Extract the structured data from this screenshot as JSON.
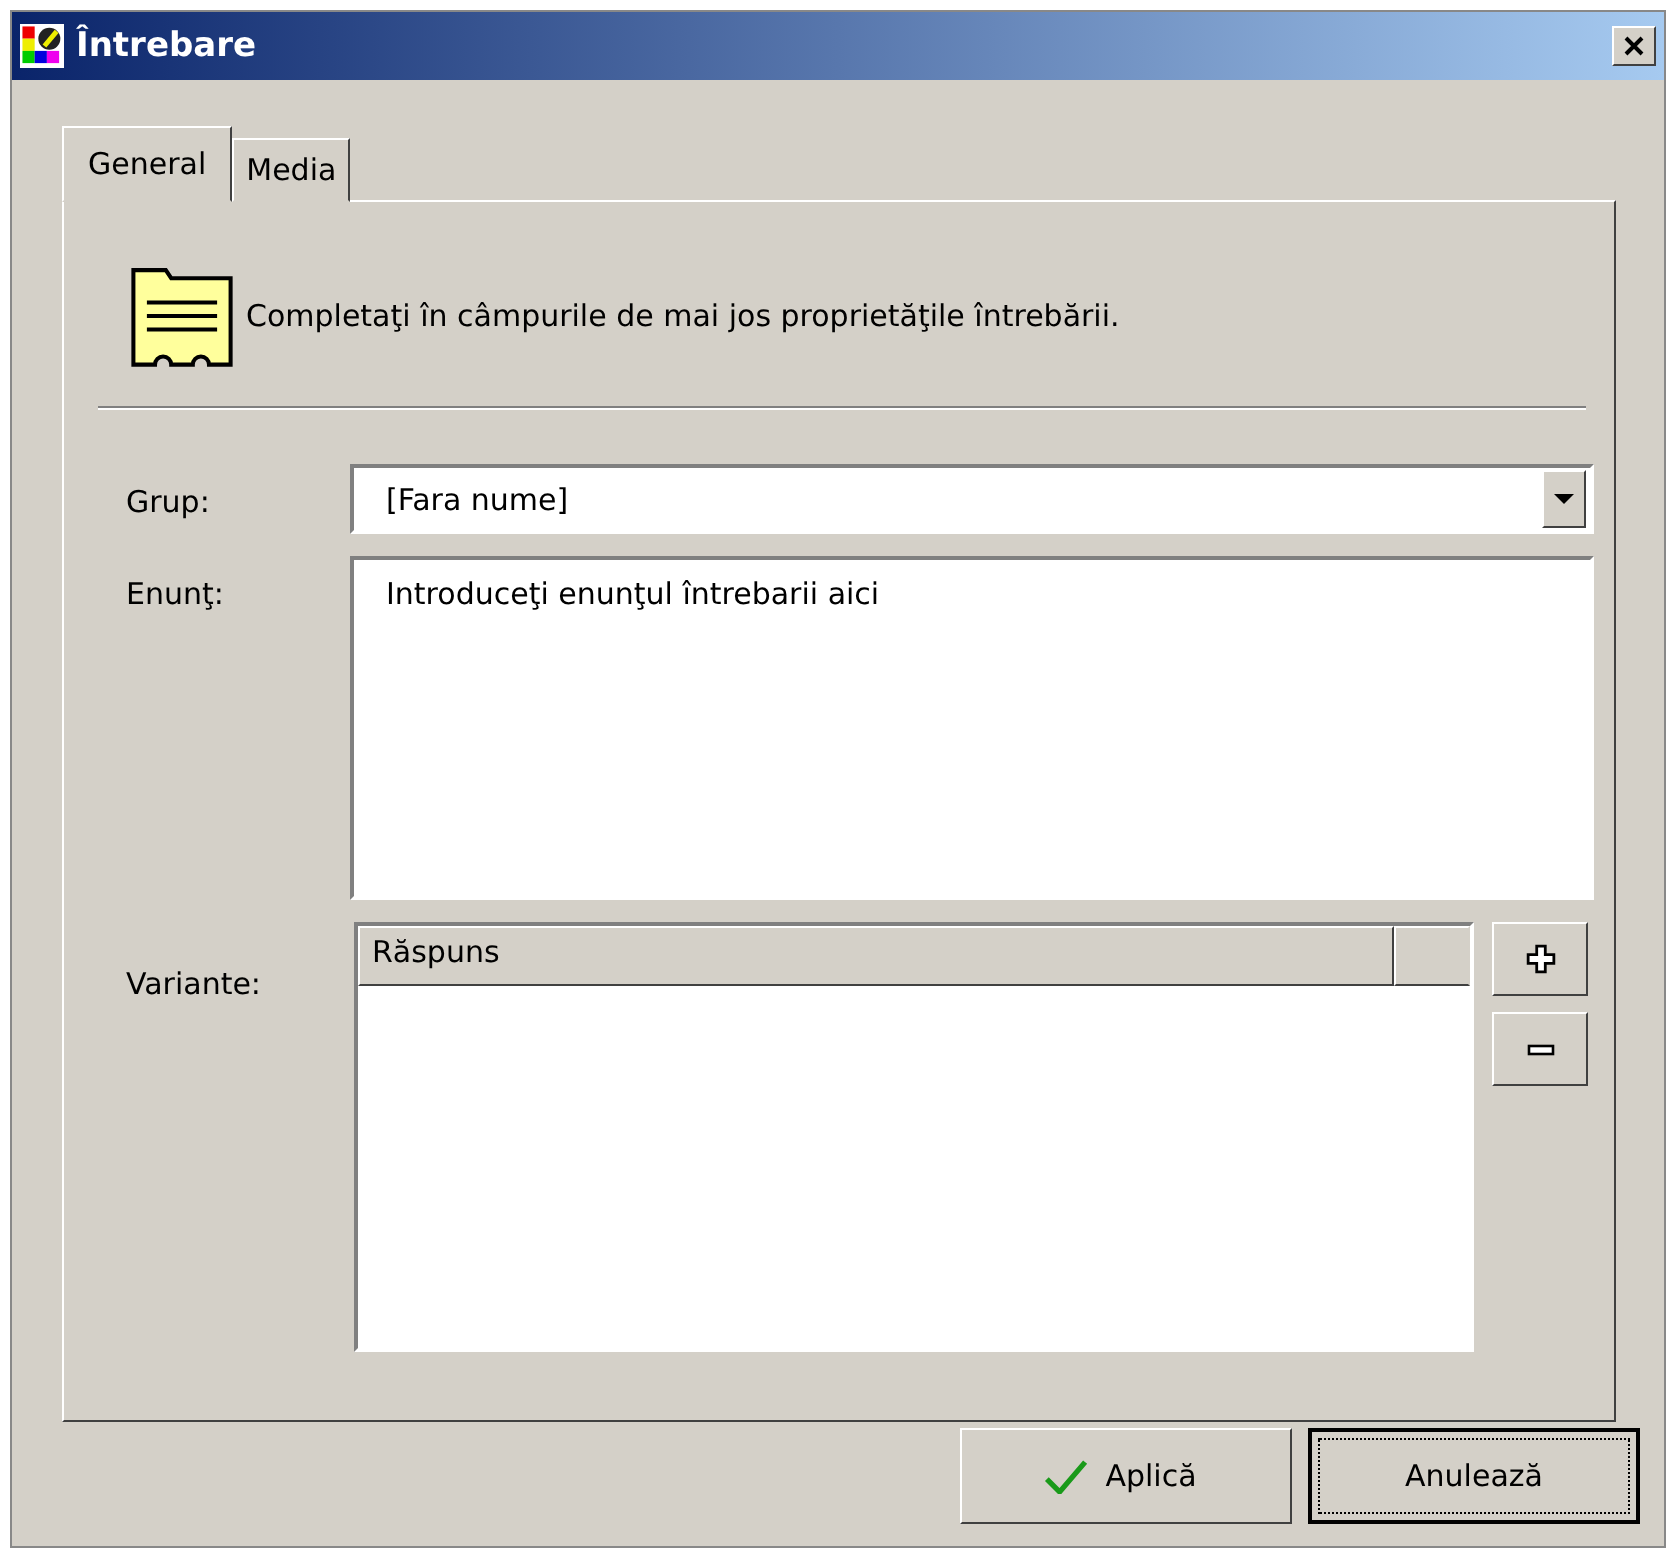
{
  "window": {
    "title": "Întrebare"
  },
  "tabs": [
    {
      "label": "General",
      "selected": true
    },
    {
      "label": "Media",
      "selected": false
    }
  ],
  "header": {
    "text": "Completaţi în câmpurile de mai jos proprietăţile întrebării."
  },
  "group": {
    "label": "Grup:",
    "value": "[Fara nume]"
  },
  "statement": {
    "label": "Enunţ:",
    "value": "Introduceţi enunţul întrebarii aici"
  },
  "variants": {
    "label": "Variante:",
    "columns": [
      "Răspuns"
    ]
  },
  "buttons": [
    {
      "label": "Aplică",
      "kind": "apply",
      "focused": false
    },
    {
      "label": "Anulează",
      "kind": "cancel",
      "focused": true
    }
  ]
}
